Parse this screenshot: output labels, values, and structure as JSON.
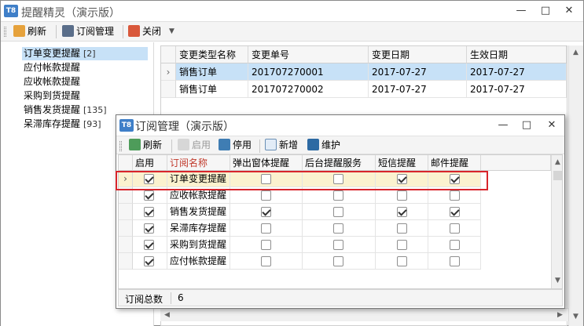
{
  "main_window": {
    "title": "提醒精灵（演示版）",
    "logo": "T8",
    "toolbar": {
      "refresh": "刷新",
      "subscription_manage": "订阅管理",
      "close": "关闭"
    },
    "left_list": [
      {
        "label": "订单变更提醒",
        "count": "[2]",
        "selected": true
      },
      {
        "label": "应付帐款提醒",
        "count": "",
        "selected": false
      },
      {
        "label": "应收帐款提醒",
        "count": "",
        "selected": false
      },
      {
        "label": "采购到货提醒",
        "count": "",
        "selected": false
      },
      {
        "label": "销售发货提醒",
        "count": "[135]",
        "selected": false
      },
      {
        "label": "呆滞库存提醒",
        "count": "[93]",
        "selected": false
      }
    ],
    "grid": {
      "columns": [
        "变更类型名称",
        "变更单号",
        "变更日期",
        "生效日期"
      ],
      "rows": [
        {
          "type": "销售订单",
          "number": "201707270001",
          "change_date": "2017-07-27",
          "effective_date": "2017-07-27"
        },
        {
          "type": "销售订单",
          "number": "201707270002",
          "change_date": "2017-07-27",
          "effective_date": "2017-07-27"
        }
      ]
    }
  },
  "dialog": {
    "title": "订阅管理（演示版）",
    "logo": "T8",
    "toolbar": {
      "refresh": "刷新",
      "enable": "启用",
      "disable": "停用",
      "add": "新增",
      "maintain": "维护"
    },
    "columns": [
      "启用",
      "订阅名称",
      "弹出窗体提醒",
      "后台提醒服务",
      "短信提醒",
      "邮件提醒"
    ],
    "rows": [
      {
        "enabled": true,
        "name": "订单变更提醒",
        "popup": false,
        "background": false,
        "sms": true,
        "email": true
      },
      {
        "enabled": true,
        "name": "应收帐款提醒",
        "popup": false,
        "background": false,
        "sms": false,
        "email": false
      },
      {
        "enabled": true,
        "name": "销售发货提醒",
        "popup": true,
        "background": false,
        "sms": true,
        "email": true
      },
      {
        "enabled": true,
        "name": "呆滞库存提醒",
        "popup": false,
        "background": false,
        "sms": false,
        "email": false
      },
      {
        "enabled": true,
        "name": "采购到货提醒",
        "popup": false,
        "background": false,
        "sms": false,
        "email": false
      },
      {
        "enabled": true,
        "name": "应付帐款提醒",
        "popup": false,
        "background": false,
        "sms": false,
        "email": false
      }
    ],
    "status": {
      "label": "订阅总数",
      "value": "6"
    }
  },
  "colors": {
    "selection_blue": "#c7e1f7",
    "selection_yellow": "#fbf2cf",
    "highlight_red": "#d8252b",
    "logo_blue": "#3f7fc8"
  }
}
